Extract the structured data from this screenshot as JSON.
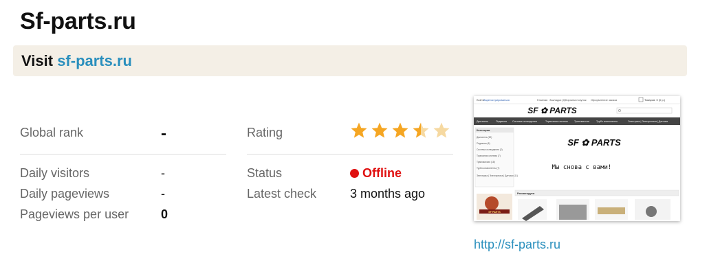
{
  "header": {
    "title": "Sf-parts.ru"
  },
  "visit": {
    "prefix": "Visit",
    "link_text": "sf-parts.ru"
  },
  "stats": {
    "global_rank": {
      "label": "Global rank",
      "value": "-"
    },
    "daily_visitors": {
      "label": "Daily visitors",
      "value": "-"
    },
    "daily_pageviews": {
      "label": "Daily pageviews",
      "value": "-"
    },
    "pageviews_per_user": {
      "label": "Pageviews per user",
      "value": "0"
    },
    "rating": {
      "label": "Rating",
      "stars": 3.5,
      "max_stars": 5
    },
    "status": {
      "label": "Status",
      "value": "Offline",
      "color": "#e01010"
    },
    "latest_check": {
      "label": "Latest check",
      "value": "3 months ago"
    }
  },
  "thumbnail": {
    "url_text": "http://sf-parts.ru",
    "logo_text": "SF ✿ PARTS",
    "slogan": "Мы снова с вами!",
    "top_links": [
      "Войти",
      "Зарегистрироваться",
      "Главная",
      "Закладки (0)",
      "Корзина покупок",
      "Оформление заказа"
    ],
    "cart_text": "Товаров: 0 (0 р.)",
    "nav_items": [
      "Двигатель",
      "Подвеска",
      "Система охлаждения",
      "Тормозная система",
      "Трансмиссия",
      "Турбо компоненты",
      "Электрика | Электроника | Датчики"
    ],
    "categories_title": "Категории",
    "categories": [
      "Двигатель (52)",
      "Подвеска (8)",
      "Система охлаждения (2)",
      "Тормозная система (7)",
      "Трансмиссия (18)",
      "Турбо компоненты (7)",
      "Электрика | Электроника | Датчики (11)"
    ],
    "recommended_title": "Рекомендуем",
    "badge_text": "SF PARTS"
  },
  "colors": {
    "accent_link": "#2a8fbd",
    "star": "#f5a623",
    "star_empty": "#f6d9a1",
    "visit_bg": "#f4efe6"
  }
}
